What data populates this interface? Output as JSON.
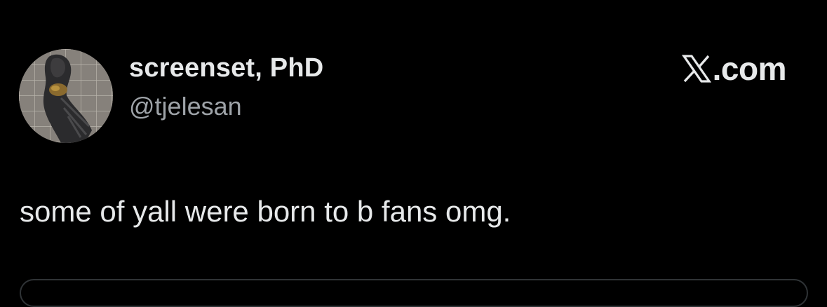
{
  "author": {
    "display_name": "screenset, PhD",
    "handle": "@tjelesan",
    "avatar_icon": "avatar-photo"
  },
  "brand": {
    "logo_icon": "x-logo-icon",
    "label": ".com"
  },
  "tweet": {
    "text": "some of yall were born to b fans omg."
  },
  "colors": {
    "background": "#000000",
    "primary_text": "#e7e9ea",
    "secondary_text": "#9ea3a8",
    "border": "#2f3336"
  }
}
